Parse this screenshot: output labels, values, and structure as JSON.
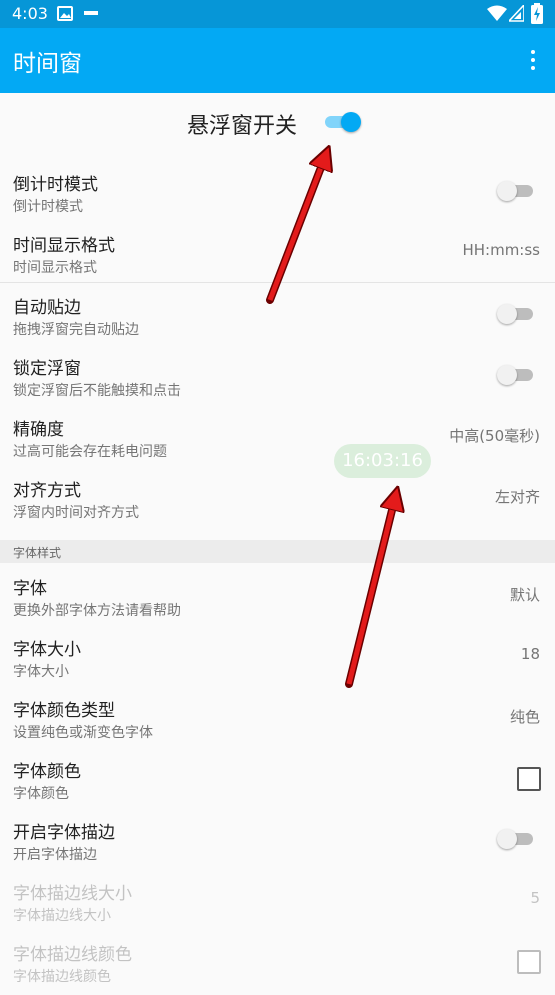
{
  "status_bar": {
    "time": "4:03"
  },
  "app_bar": {
    "title": "时间窗",
    "more_icon": "more-vert-icon"
  },
  "master_switch": {
    "label": "悬浮窗开关",
    "on": true
  },
  "floating_clock": {
    "time": "16:03:16"
  },
  "settings_general": [
    {
      "title": "倒计时模式",
      "summary": "倒计时模式",
      "control": "toggle",
      "on": false
    },
    {
      "title": "时间显示格式",
      "summary": "时间显示格式",
      "control": "value",
      "value": "HH:mm:ss"
    },
    {
      "title": "自动贴边",
      "summary": "拖拽浮窗完自动贴边",
      "control": "toggle",
      "on": false
    },
    {
      "title": "锁定浮窗",
      "summary": "锁定浮窗后不能触摸和点击",
      "control": "toggle",
      "on": false
    },
    {
      "title": "精确度",
      "summary": "过高可能会存在耗电问题",
      "control": "value",
      "value": "中高(50毫秒)"
    },
    {
      "title": "对齐方式",
      "summary": "浮窗内时间对齐方式",
      "control": "value",
      "value": "左对齐"
    }
  ],
  "section_font": {
    "label": "字体样式"
  },
  "settings_font": [
    {
      "title": "字体",
      "summary": "更换外部字体方法请看帮助",
      "control": "value",
      "value": "默认"
    },
    {
      "title": "字体大小",
      "summary": "字体大小",
      "control": "value",
      "value": "18"
    },
    {
      "title": "字体颜色类型",
      "summary": "设置纯色或渐变色字体",
      "control": "value",
      "value": "纯色"
    },
    {
      "title": "字体颜色",
      "summary": "字体颜色",
      "control": "checkbox"
    },
    {
      "title": "开启字体描边",
      "summary": "开启字体描边",
      "control": "toggle",
      "on": false
    },
    {
      "title": "字体描边线大小",
      "summary": "字体描边线大小",
      "control": "value",
      "value": "5",
      "disabled": true
    },
    {
      "title": "字体描边线颜色",
      "summary": "字体描边线颜色",
      "control": "checkbox",
      "disabled": true
    }
  ],
  "colors": {
    "primary": "#03a9f4",
    "primary_dark": "#0696d7",
    "annotation_arrow": "#e31b1b"
  }
}
